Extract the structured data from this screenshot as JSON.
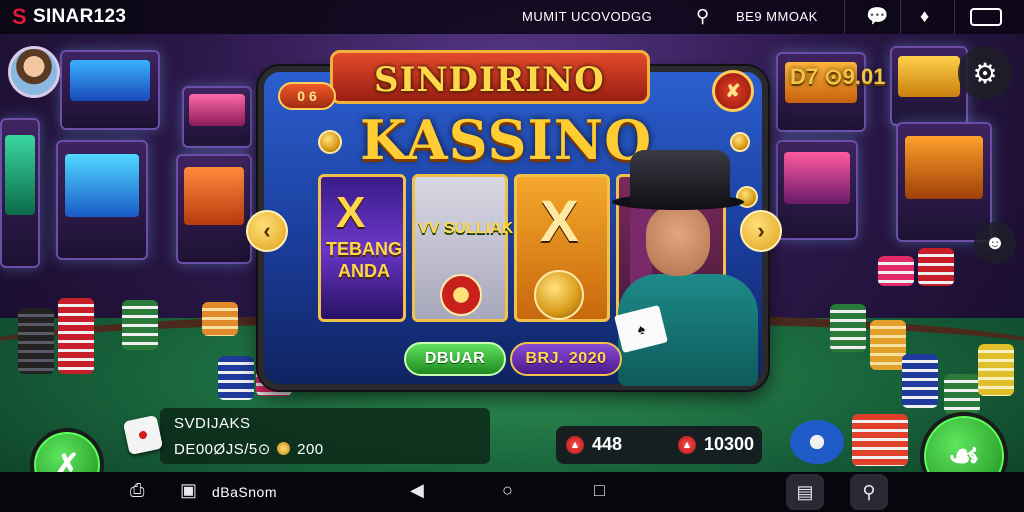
{
  "status_bar": {
    "brand_name": "SINAR123",
    "center_text": "MUMIT UCOVODGG",
    "right_text": "BE9 MMOAK"
  },
  "balance": {
    "value": "D7 ⊙9.01"
  },
  "game_panel": {
    "badge": "0 6",
    "subtitle": "SINDIRINO",
    "title": "KASSINO",
    "reels": [
      {
        "label": "TEBANG ANDA"
      },
      {
        "label": "VV SULLIAK"
      },
      {
        "label": "X"
      },
      {
        "label": ""
      }
    ],
    "primary_button": "DBUAR",
    "secondary_button": "BRJ. 2020"
  },
  "info_panel": {
    "title": "SVDIJAKS",
    "line_prefix": "DE00ØJS/5⊙",
    "line_value": "200"
  },
  "stats": {
    "left_value": "448",
    "right_value": "10300"
  },
  "nav_bar": {
    "label": "dBaSnom"
  },
  "colors": {
    "accent_gold": "#f3c544",
    "accent_green": "#2eb82e",
    "brand_red": "#e0183a",
    "panel_blue": "#2b5fcf"
  },
  "icons": {
    "brand": "brand-logo-icon",
    "search": "search-icon",
    "chat": "chat-bubble-icon",
    "cards": "cards-icon",
    "battery": "battery-icon",
    "settings": "gear-icon",
    "bot": "robot-icon",
    "prev": "chevron-left-icon",
    "next": "chevron-right-icon",
    "back": "back-triangle-icon",
    "home": "home-circle-icon",
    "recents": "recents-square-icon"
  }
}
